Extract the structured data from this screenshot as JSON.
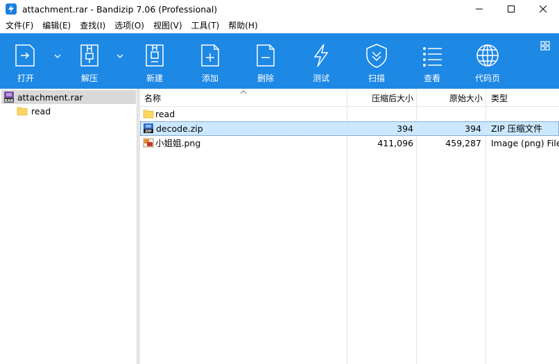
{
  "window": {
    "title": "attachment.rar - Bandizip 7.06 (Professional)"
  },
  "menu": [
    "文件(F)",
    "编辑(E)",
    "查找(I)",
    "选项(O)",
    "视图(V)",
    "工具(T)",
    "帮助(H)"
  ],
  "toolbar": {
    "open": "打开",
    "extract": "解压",
    "new": "新建",
    "add": "添加",
    "delete": "删除",
    "test": "测试",
    "scan": "扫描",
    "view": "查看",
    "codepage": "代码页"
  },
  "tree": {
    "root": "attachment.rar",
    "child": "read"
  },
  "columns": {
    "name": "名称",
    "compressed": "压缩后大小",
    "original": "原始大小",
    "type": "类型"
  },
  "files": [
    {
      "name": "read",
      "compressed": "",
      "original": "",
      "type": ""
    },
    {
      "name": "decode.zip",
      "compressed": "394",
      "original": "394",
      "type": "ZIP 压缩文件"
    },
    {
      "name": "小姐姐.png",
      "compressed": "411,096",
      "original": "459,287",
      "type": "Image (png) File"
    }
  ],
  "colors": {
    "toolbar": "#1e88e5",
    "selection": "#cce8ff",
    "folder": "#ffd75e"
  }
}
